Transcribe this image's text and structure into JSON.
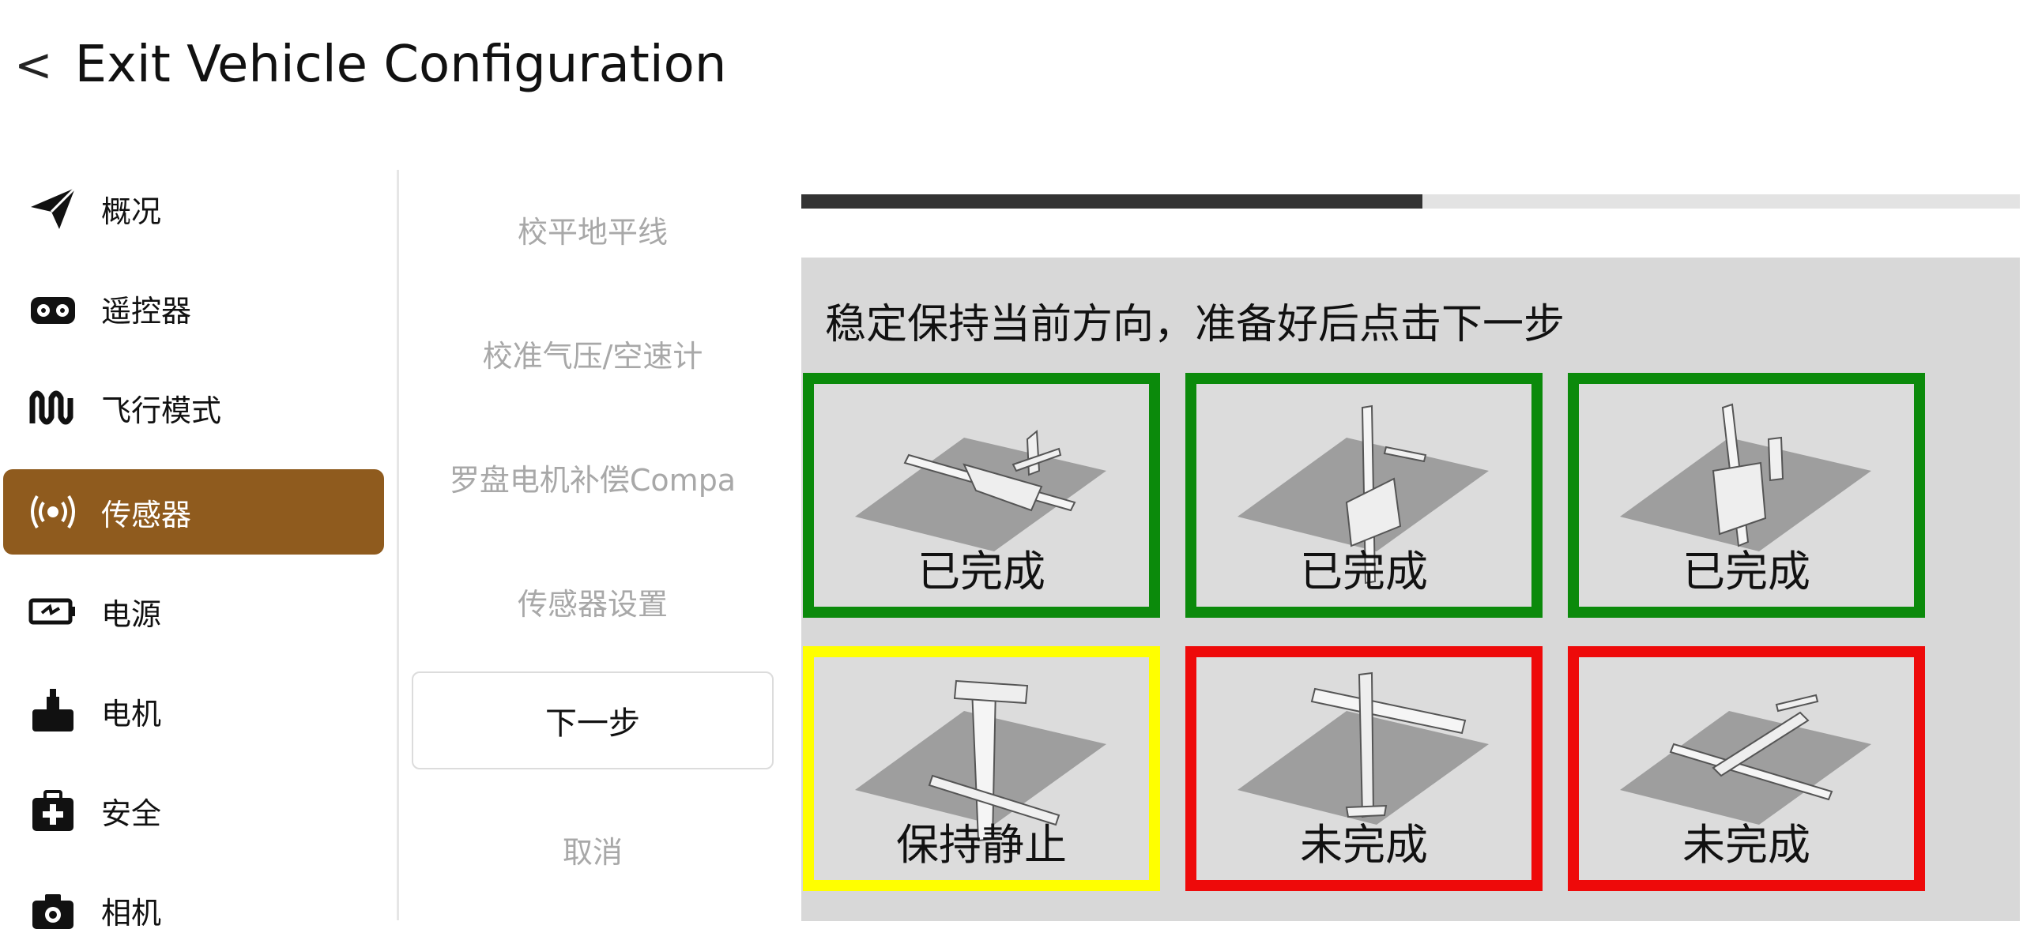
{
  "header": {
    "back_symbol": "<",
    "title": "Exit Vehicle Configuration"
  },
  "sidebar": {
    "items": [
      {
        "label": "概况",
        "icon": "paper-plane-icon"
      },
      {
        "label": "遥控器",
        "icon": "radio-controller-icon"
      },
      {
        "label": "飞行模式",
        "icon": "flight-mode-wave-icon"
      },
      {
        "label": "传感器",
        "icon": "sensor-broadcast-icon",
        "active": true
      },
      {
        "label": "电源",
        "icon": "battery-icon"
      },
      {
        "label": "电机",
        "icon": "motor-icon"
      },
      {
        "label": "安全",
        "icon": "first-aid-kit-icon"
      },
      {
        "label": "相机",
        "icon": "camera-icon"
      }
    ]
  },
  "middle": {
    "items": [
      "校平地平线",
      "校准气压/空速计",
      "罗盘电机补偿Compa",
      "传感器设置"
    ],
    "next_button": "下一步",
    "cancel": "取消"
  },
  "progress": {
    "fraction": 0.51
  },
  "calibration": {
    "instruction": "稳定保持当前方向，准备好后点击下一步",
    "tiles": [
      {
        "status": "已完成",
        "state": "complete",
        "color": "#0b8a0b"
      },
      {
        "status": "已完成",
        "state": "complete",
        "color": "#0b8a0b"
      },
      {
        "status": "已完成",
        "state": "complete",
        "color": "#0b8a0b"
      },
      {
        "status": "保持静止",
        "state": "in-progress",
        "color": "#ffff00"
      },
      {
        "status": "未完成",
        "state": "incomplete",
        "color": "#ee0a0a"
      },
      {
        "status": "未完成",
        "state": "incomplete",
        "color": "#ee0a0a"
      }
    ]
  },
  "colors": {
    "accent": "#8f5b1e",
    "progress_fill": "#333333"
  }
}
